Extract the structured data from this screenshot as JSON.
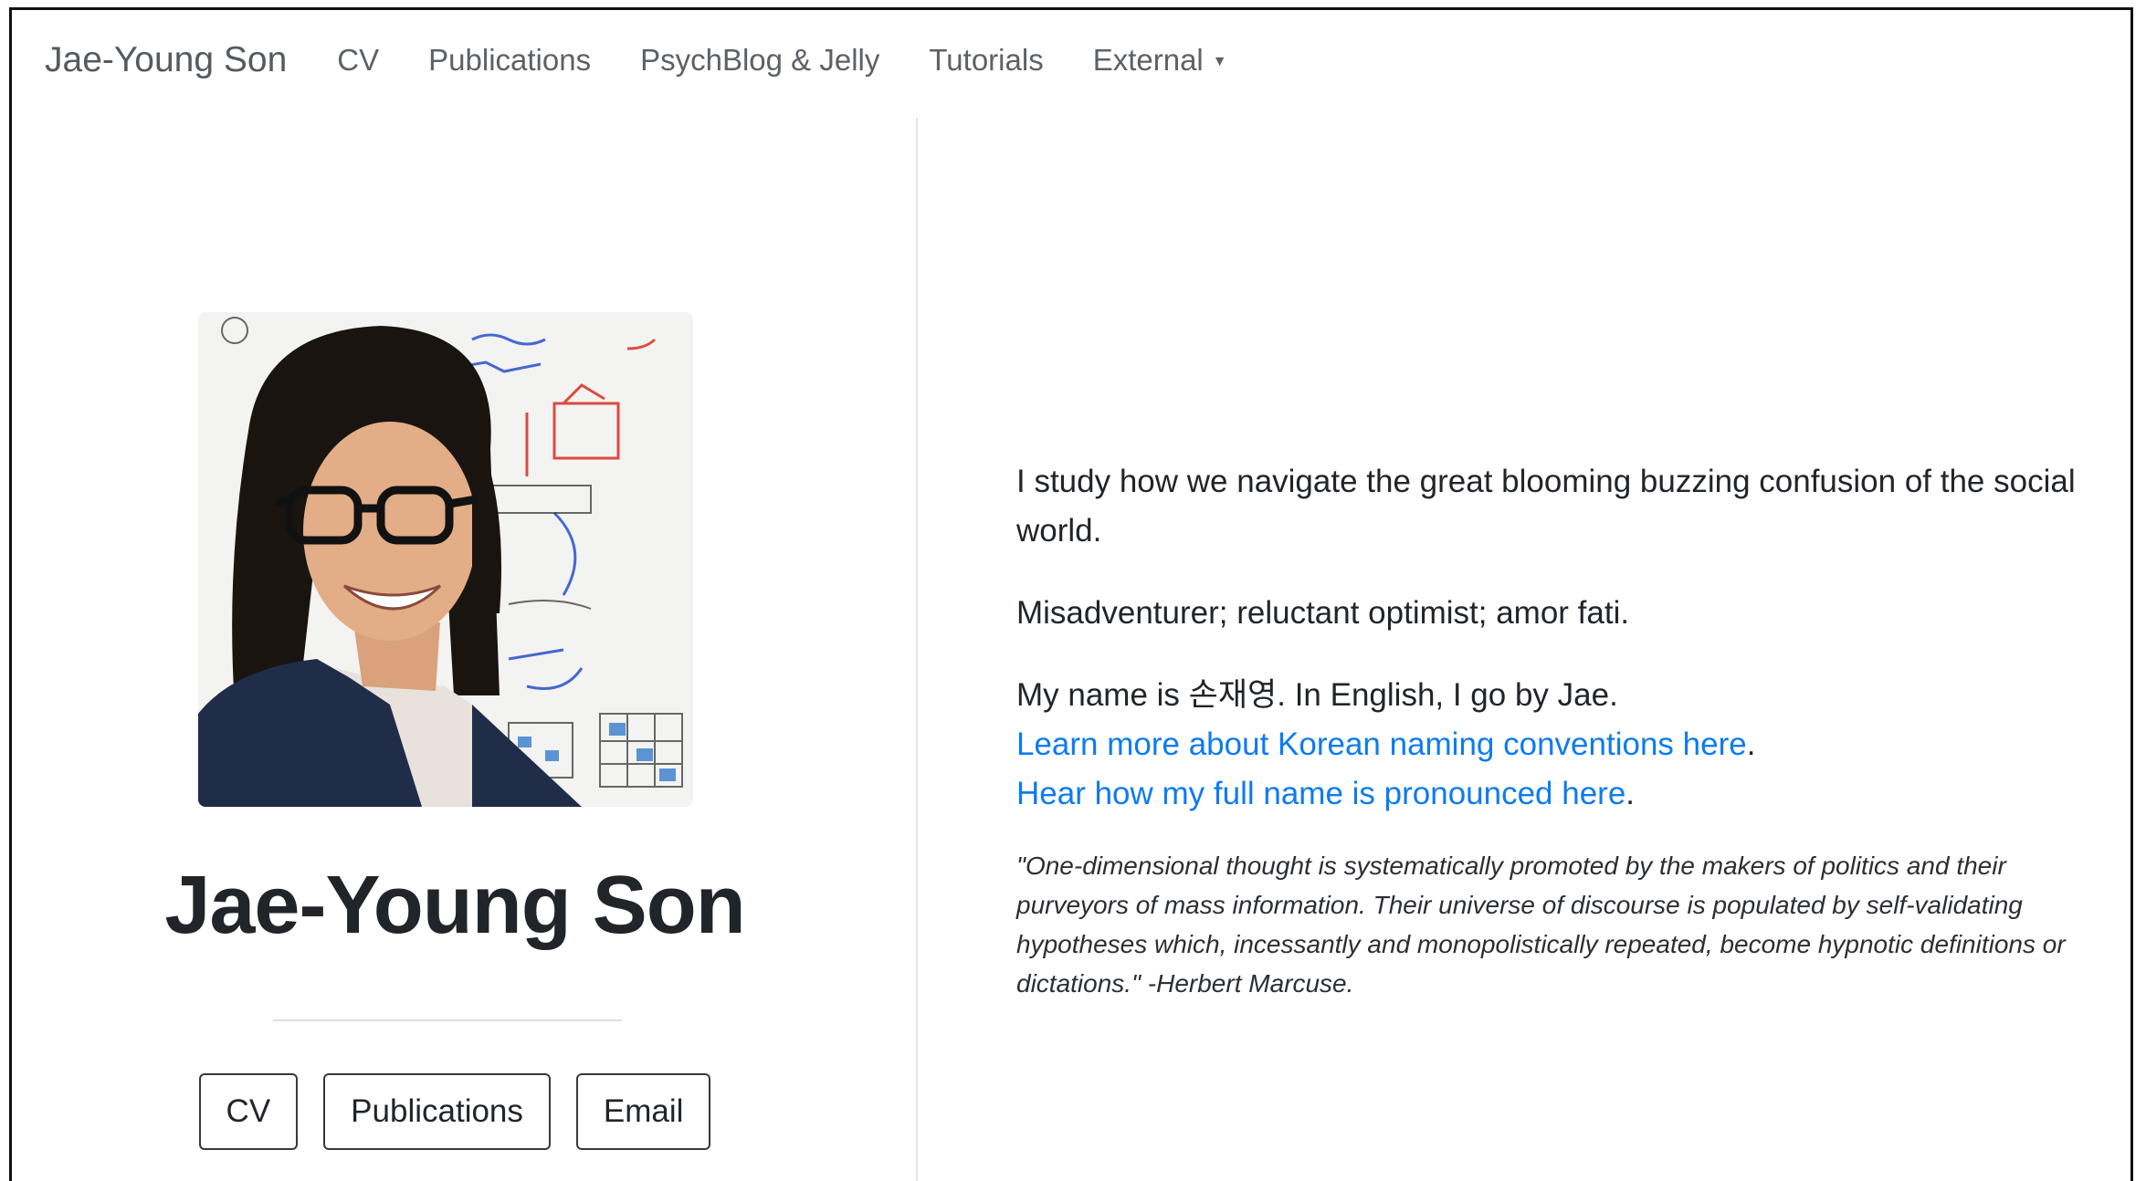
{
  "navbar": {
    "brand": "Jae-Young Son",
    "items": [
      {
        "label": "CV"
      },
      {
        "label": "Publications"
      },
      {
        "label": "PsychBlog & Jelly"
      },
      {
        "label": "Tutorials"
      },
      {
        "label": "External"
      }
    ]
  },
  "profile": {
    "name": "Jae-Young Son",
    "buttons": {
      "cv": "CV",
      "publications": "Publications",
      "email": "Email"
    }
  },
  "bio": {
    "intro": "I study how we navigate the great blooming buzzing confusion of the social world.",
    "tagline": "Misadventurer; reluctant optimist; amor fati.",
    "name_sentence": "My name is 손재영. In English, I go by Jae.",
    "link_naming": "Learn more about Korean naming conventions here",
    "link_pronounce": "Hear how my full name is pronounced here",
    "period": ".",
    "quote": "\"One-dimensional thought is systematically promoted by the makers of politics and their purveyors of mass information. Their universe of discourse is populated by self-validating hypotheses which, incessantly and monopolistically repeated, become hypnotic definitions or dictations.\" -Herbert Marcuse."
  },
  "colors": {
    "link": "#0d7bf2",
    "text": "#212529",
    "nav": "#5c6166"
  }
}
